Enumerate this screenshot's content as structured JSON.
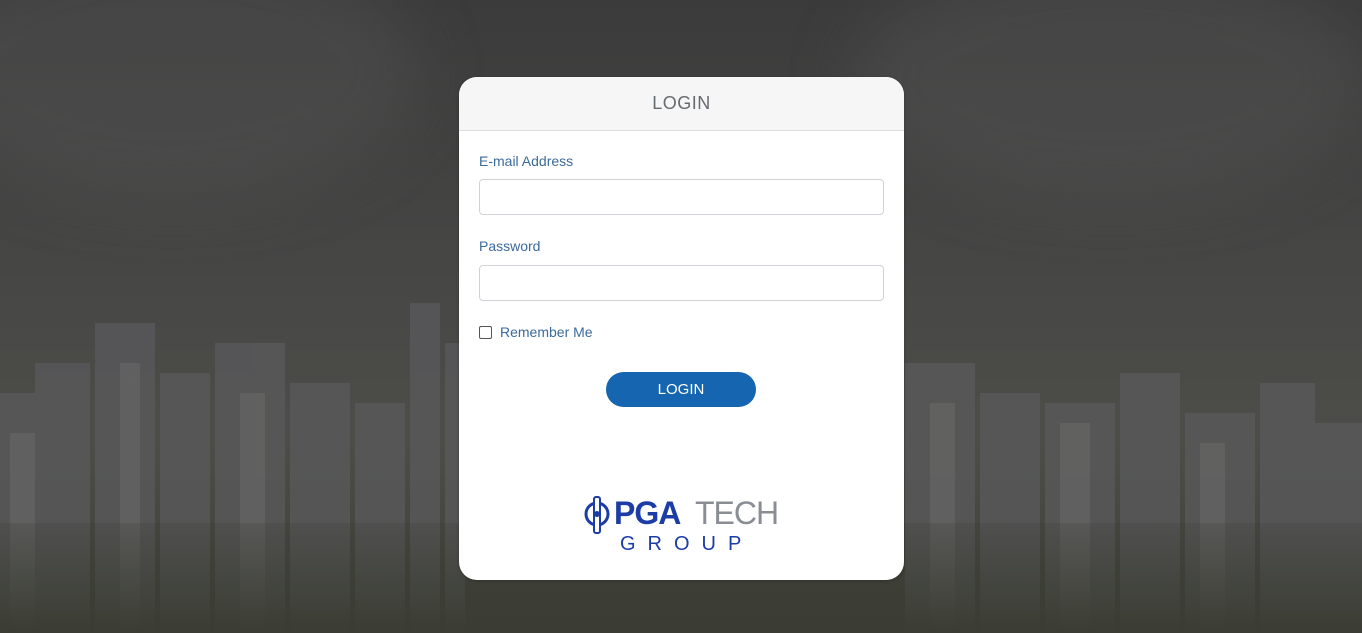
{
  "header": {
    "title": "LOGIN"
  },
  "form": {
    "email_label": "E-mail Address",
    "email_value": "",
    "password_label": "Password",
    "password_value": "",
    "remember_label": "Remember Me",
    "remember_checked": false,
    "submit_label": "LOGIN"
  },
  "logo": {
    "mark_icon": "pga-logo-mark-icon",
    "word_primary": "PGA",
    "word_secondary": "TECH",
    "word_tertiary": "GROUP",
    "primary_color": "#1c3ca6",
    "secondary_color": "#8a8d93"
  },
  "colors": {
    "button": "#1565b0",
    "label": "#3b6a9c"
  }
}
